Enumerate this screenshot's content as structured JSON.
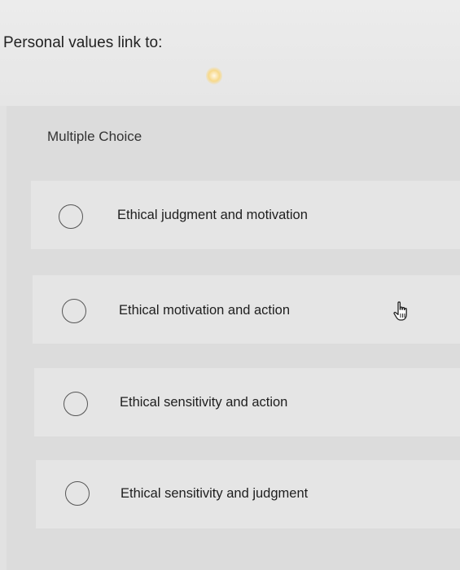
{
  "question": {
    "text": "Personal values link to:"
  },
  "section": {
    "label": "Multiple Choice"
  },
  "options": [
    {
      "label": "Ethical judgment and motivation",
      "selected": false
    },
    {
      "label": "Ethical motivation and action",
      "selected": false
    },
    {
      "label": "Ethical sensitivity and action",
      "selected": false
    },
    {
      "label": "Ethical sensitivity and judgment",
      "selected": false
    }
  ],
  "icons": {
    "cursor": "hand-pointer-icon",
    "radio": "radio-circle-icon"
  },
  "colors": {
    "background": "#e2e2e2",
    "radio_border": "#555555",
    "text": "#222222"
  }
}
